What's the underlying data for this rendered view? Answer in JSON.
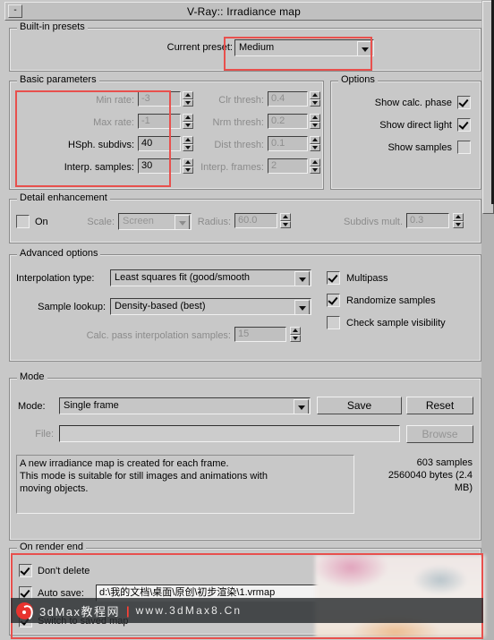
{
  "window": {
    "title": "V-Ray:: Irradiance map",
    "collapse_glyph": "-"
  },
  "built_in_presets": {
    "group_label": "Built-in presets",
    "current_preset_label": "Current preset:",
    "current_preset_value": "Medium"
  },
  "basic_parameters": {
    "group_label": "Basic parameters",
    "left": [
      {
        "label": "Min rate:",
        "value": "-3",
        "disabled": true
      },
      {
        "label": "Max rate:",
        "value": "-1",
        "disabled": true
      },
      {
        "label": "HSph. subdivs:",
        "value": "40",
        "disabled": false
      },
      {
        "label": "Interp. samples:",
        "value": "30",
        "disabled": false
      }
    ],
    "right": [
      {
        "label": "Clr thresh:",
        "value": "0.4",
        "disabled": true
      },
      {
        "label": "Nrm thresh:",
        "value": "0.2",
        "disabled": true
      },
      {
        "label": "Dist thresh:",
        "value": "0.1",
        "disabled": true
      },
      {
        "label": "Interp. frames:",
        "value": "2",
        "disabled": true
      }
    ]
  },
  "options": {
    "group_label": "Options",
    "items": [
      {
        "label": "Show calc. phase",
        "checked": true
      },
      {
        "label": "Show direct light",
        "checked": true
      },
      {
        "label": "Show samples",
        "checked": false
      }
    ]
  },
  "detail_enhancement": {
    "group_label": "Detail enhancement",
    "on_label": "On",
    "on_checked": false,
    "scale_label": "Scale:",
    "scale_value": "Screen",
    "radius_label": "Radius:",
    "radius_value": "60.0",
    "subdivs_mult_label": "Subdivs mult.",
    "subdivs_mult_value": "0.3"
  },
  "advanced_options": {
    "group_label": "Advanced options",
    "interpolation_type_label": "Interpolation type:",
    "interpolation_type_value": "Least squares fit (good/smooth",
    "sample_lookup_label": "Sample lookup:",
    "sample_lookup_value": "Density-based (best)",
    "calc_pass_label": "Calc. pass interpolation samples:",
    "calc_pass_value": "15",
    "checks": [
      {
        "label": "Multipass",
        "checked": true
      },
      {
        "label": "Randomize samples",
        "checked": true
      },
      {
        "label": "Check sample visibility",
        "checked": false
      }
    ]
  },
  "mode": {
    "group_label": "Mode",
    "mode_label": "Mode:",
    "mode_value": "Single frame",
    "save_label": "Save",
    "reset_label": "Reset",
    "file_label": "File:",
    "file_value": "",
    "browse_label": "Browse",
    "description_line1": "A new irradiance map is created for each frame.",
    "description_line2": "This mode is suitable for still images and animations with",
    "description_line3": "moving objects.",
    "stats_line1": "603 samples",
    "stats_line2": "2560040 bytes (2.4",
    "stats_line3": "MB)"
  },
  "on_render_end": {
    "group_label": "On render end",
    "dont_delete_label": "Don't delete",
    "dont_delete_checked": true,
    "auto_save_label": "Auto save:",
    "auto_save_checked": true,
    "auto_save_path": "d:\\我的文档\\桌面\\原创\\初步渲染\\1.vrmap",
    "switch_label": "Switch to saved map",
    "switch_checked": true
  },
  "watermark": {
    "logo_icon": "spiral-logo-icon",
    "site_name": "3dMax教程网",
    "separator": "|",
    "url": "www.3dMax8.Cn"
  },
  "annotations": {
    "highlight_color": "#e8504d"
  }
}
